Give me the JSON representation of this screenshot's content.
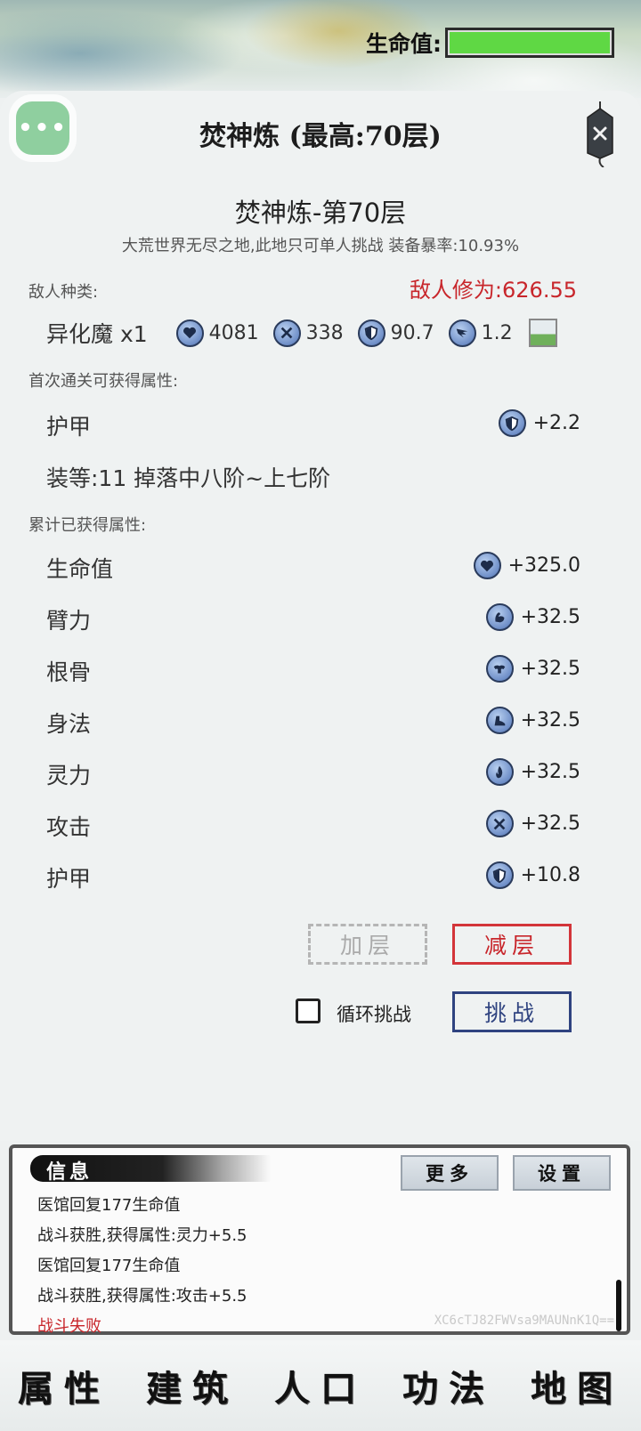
{
  "header": {
    "hp_label": "生命值:",
    "hp_fraction": 1.0,
    "hp_color": "#5fd844"
  },
  "panel": {
    "menu_label": "•••",
    "title": "焚神炼 (最高:70层)",
    "stage_title": "焚神炼-第70层",
    "stage_subtitle": "大荒世界无尽之地,此地只可单人挑战 装备暴率:10.93%"
  },
  "enemy": {
    "section_label": "敌人种类:",
    "power_label": "敌人修为:626.55",
    "name": "异化魔 x1",
    "stats": [
      {
        "icon": "heart-icon",
        "value": "4081"
      },
      {
        "icon": "sword-icon",
        "value": "338"
      },
      {
        "icon": "shield-icon",
        "value": "90.7"
      },
      {
        "icon": "wing-icon",
        "value": "1.2"
      }
    ]
  },
  "first_clear": {
    "section_label": "首次通关可获得属性:",
    "items": [
      {
        "name": "护甲",
        "icon": "shield-icon",
        "value": "+2.2"
      }
    ],
    "equip_line": "装等:11 掉落中八阶~上七阶"
  },
  "accumulated": {
    "section_label": "累计已获得属性:",
    "items": [
      {
        "name": "生命值",
        "icon": "heart-icon",
        "value": "+325.0"
      },
      {
        "name": "臂力",
        "icon": "arm-icon",
        "value": "+32.5"
      },
      {
        "name": "根骨",
        "icon": "body-icon",
        "value": "+32.5"
      },
      {
        "name": "身法",
        "icon": "boot-icon",
        "value": "+32.5"
      },
      {
        "name": "灵力",
        "icon": "flame-icon",
        "value": "+32.5"
      },
      {
        "name": "攻击",
        "icon": "sword-icon",
        "value": "+32.5"
      },
      {
        "name": "护甲",
        "icon": "shield-icon",
        "value": "+10.8"
      }
    ]
  },
  "actions": {
    "add_label": "加层",
    "sub_label": "减层",
    "loop_label": "循环挑战",
    "fight_label": "挑战"
  },
  "info": {
    "tag_label": "信息",
    "more_label": "更多",
    "settings_label": "设置",
    "log": [
      {
        "text": "医馆回复177生命值",
        "type": "normal"
      },
      {
        "text": "战斗获胜,获得属性:灵力+5.5",
        "type": "normal"
      },
      {
        "text": "医馆回复177生命值",
        "type": "normal"
      },
      {
        "text": "战斗获胜,获得属性:攻击+5.5",
        "type": "normal"
      },
      {
        "text": "战斗失败",
        "type": "fail"
      }
    ],
    "watermark": "XC6cTJ82FWVsa9MAUNnK1Q=="
  },
  "nav": {
    "items": [
      "属性",
      "建筑",
      "人口",
      "功法",
      "地图"
    ]
  }
}
